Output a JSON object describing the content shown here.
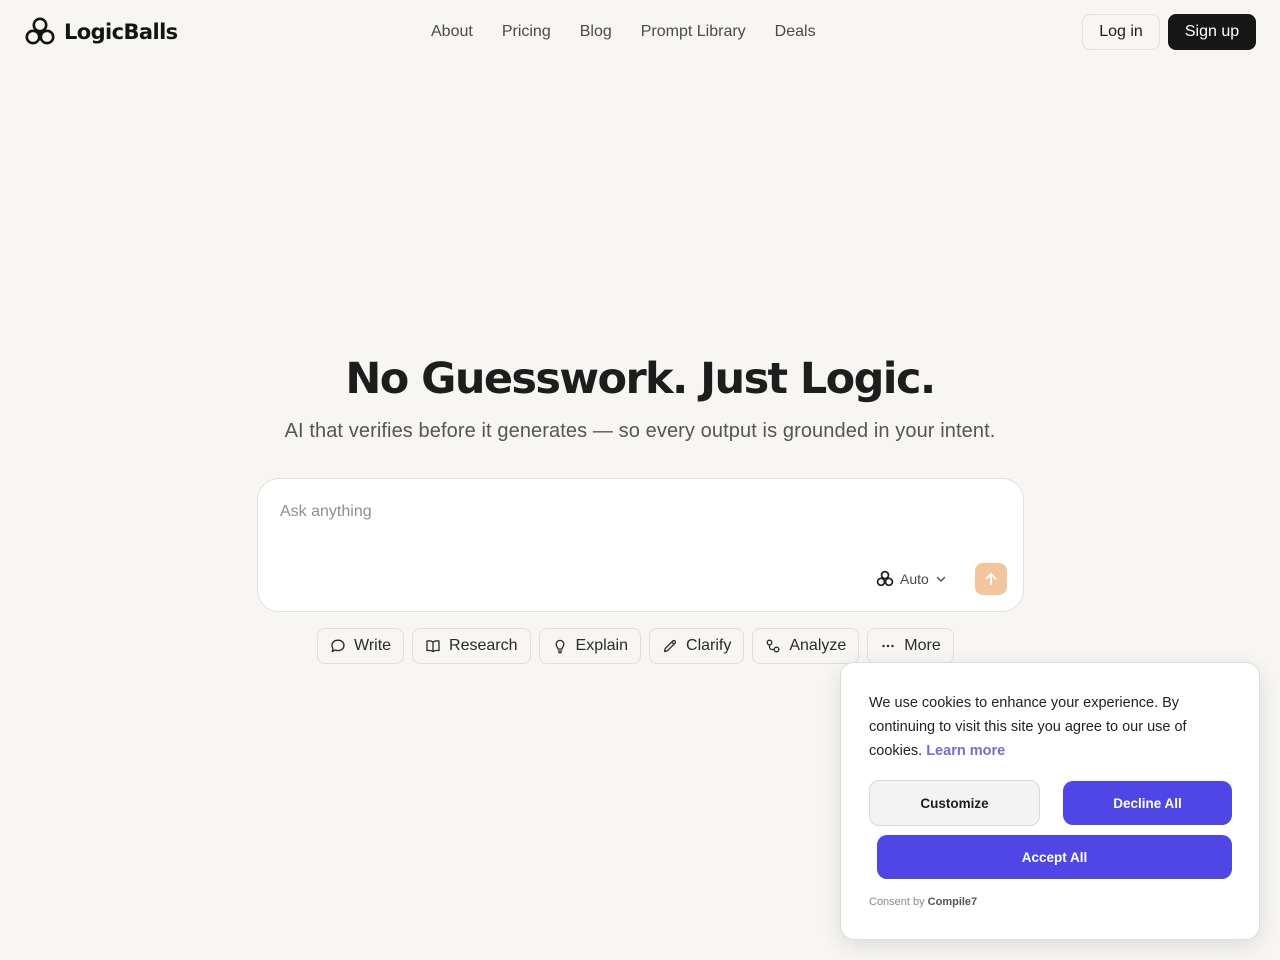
{
  "header": {
    "brand": "LogicBalls",
    "nav": [
      "About",
      "Pricing",
      "Blog",
      "Prompt Library",
      "Deals"
    ],
    "login_label": "Log in",
    "signup_label": "Sign up"
  },
  "hero": {
    "title": "No Guesswork. Just Logic.",
    "subtitle": "AI that verifies before it generates — so every output is grounded in your intent."
  },
  "prompt": {
    "placeholder": "Ask anything",
    "model_label": "Auto",
    "send_icon": "arrow-up-icon"
  },
  "actions": [
    {
      "label": "Write",
      "icon": "chat-bubble-icon"
    },
    {
      "label": "Research",
      "icon": "book-icon"
    },
    {
      "label": "Explain",
      "icon": "lightbulb-icon"
    },
    {
      "label": "Clarify",
      "icon": "pencil-icon"
    },
    {
      "label": "Analyze",
      "icon": "link-nodes-icon"
    },
    {
      "label": "More",
      "icon": "more-dots-icon"
    }
  ],
  "cookie": {
    "text": "We use cookies to enhance your experience. By continuing to visit this site you agree to our use of cookies.",
    "learn_more": "Learn more",
    "customize_label": "Customize",
    "decline_label": "Decline All",
    "accept_label": "Accept All",
    "consent_prefix": "Consent by",
    "consent_brand": "Compile7"
  },
  "colors": {
    "background": "#f7f6f2",
    "primary_dark": "#161616",
    "accent_purple": "#4f46e5",
    "send_button": "#f3c59f",
    "link_purple": "#7a6bc9"
  }
}
